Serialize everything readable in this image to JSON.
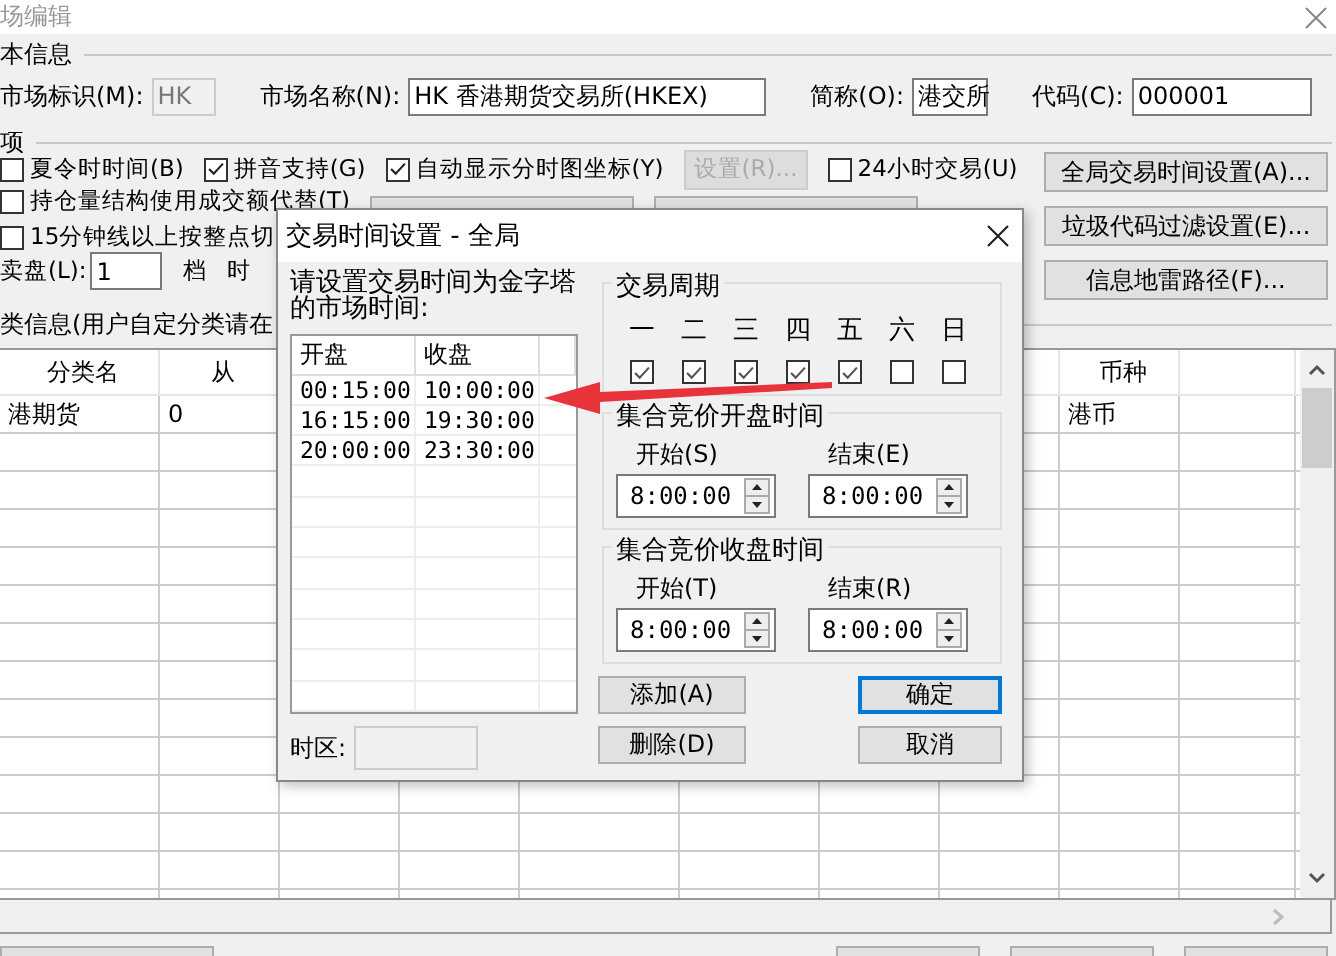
{
  "window": {
    "title": "场编辑"
  },
  "basic_info": {
    "title": "本信息",
    "fields": [
      {
        "label": "市场标识(M):",
        "value": "HK",
        "disabled": true
      },
      {
        "label": "市场名称(N):",
        "value": "HK 香港期货交易所(HKEX)",
        "disabled": false
      },
      {
        "label": "简称(O):",
        "value": "港交所",
        "disabled": false
      },
      {
        "label": "代码(C):",
        "value": "000001",
        "disabled": false
      }
    ]
  },
  "options": {
    "title": "项",
    "rows": [
      {
        "items": [
          {
            "kind": "checkbox",
            "label": "夏令时时间(B)",
            "checked": false
          },
          {
            "kind": "checkbox",
            "label": "拼音支持(G)",
            "checked": true
          },
          {
            "kind": "checkbox",
            "label": "自动显示分时图坐标(Y)",
            "checked": true
          },
          {
            "kind": "button",
            "label": "设置(R)...",
            "disabled": true
          },
          {
            "kind": "checkbox",
            "label": "24小时交易(U)",
            "checked": false
          }
        ]
      },
      {
        "items": [
          {
            "kind": "checkbox",
            "label": "持仓量结构使用成交额代替(T)",
            "checked": false
          },
          {
            "kind": "button"
          },
          {
            "kind": "button"
          }
        ]
      },
      {
        "items": [
          {
            "kind": "checkbox",
            "label": "15分钟线以上按整点切",
            "checked": false
          }
        ]
      },
      {
        "items": [
          {
            "kind": "field",
            "label": "卖盘(L):",
            "value": "1"
          },
          {
            "kind": "text",
            "label": "档"
          },
          {
            "kind": "text",
            "label": "时"
          }
        ]
      }
    ],
    "buttons": [
      {
        "label": "全局交易时间设置(A)..."
      },
      {
        "label": "垃圾代码过滤设置(E)..."
      },
      {
        "label": "信息地雷路径(F)..."
      }
    ]
  },
  "category_info": {
    "title": "类信息(用户自定分类请在",
    "table": {
      "columns": [
        {
          "label": "分类名"
        },
        {
          "label": "从"
        },
        {},
        {},
        {},
        {},
        {},
        {},
        {
          "label": "币种"
        },
        {}
      ],
      "rows": [
        {
          "cells": [
            "港期货",
            "0",
            null,
            null,
            null,
            null,
            null,
            null,
            "港币",
            null
          ]
        }
      ]
    }
  },
  "dialog": {
    "title": "交易时间设置 - 全局",
    "prompt": "请设置交易时间为金字塔的市场时间:",
    "sessions": {
      "columns": [
        "开盘",
        "收盘"
      ],
      "rows": [
        [
          "00:15:00",
          "10:00:00"
        ],
        [
          "16:15:00",
          "19:30:00"
        ],
        [
          "20:00:00",
          "23:30:00"
        ]
      ]
    },
    "timezone": {
      "label": "时区:"
    },
    "week": {
      "title": "交易周期",
      "days": [
        {
          "label": "一",
          "checked": true
        },
        {
          "label": "二",
          "checked": true
        },
        {
          "label": "三",
          "checked": true
        },
        {
          "label": "四",
          "checked": true
        },
        {
          "label": "五",
          "checked": true
        },
        {
          "label": "六",
          "checked": false
        },
        {
          "label": "日",
          "checked": false
        }
      ]
    },
    "auctions": [
      {
        "title": "集合竞价开盘时间",
        "start": {
          "label": "开始(S)",
          "value": "8:00:00"
        },
        "end": {
          "label": "结束(E)",
          "value": "8:00:00"
        }
      },
      {
        "title": "集合竞价收盘时间",
        "start": {
          "label": "开始(T)",
          "value": "8:00:00"
        },
        "end": {
          "label": "结束(R)",
          "value": "8:00:00"
        }
      }
    ],
    "buttons": [
      {
        "label": "添加(A)",
        "default": false
      },
      {
        "label": "确定",
        "default": true
      },
      {
        "label": "删除(D)",
        "default": false
      },
      {
        "label": "取消",
        "default": false
      }
    ]
  }
}
